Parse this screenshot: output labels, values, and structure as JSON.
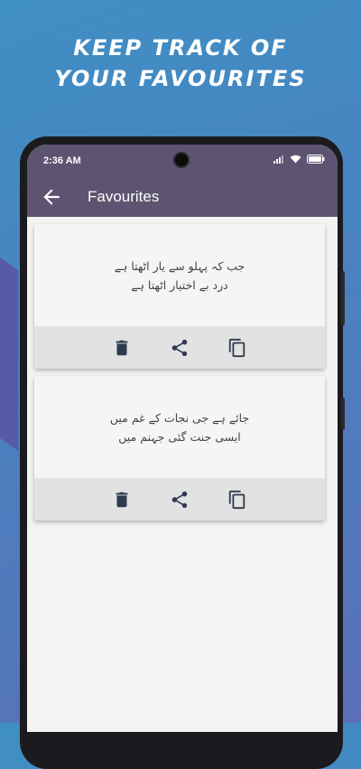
{
  "headline": [
    "KEEP TRACK OF",
    "YOUR FAVOURITES"
  ],
  "status_bar": {
    "time": "2:36 AM"
  },
  "app_bar": {
    "title": "Favourites"
  },
  "cards": [
    {
      "lines": [
        "جب کہ پہلو سے یار اٹھتا ہے",
        "درد بے اختیار اٹھتا ہے"
      ]
    },
    {
      "lines": [
        "جائے ہے جی نجات کے غم میں",
        "ایسی جنت گئی جہنم میں"
      ]
    }
  ],
  "icons": {
    "back": "arrow-back-icon",
    "delete": "trash-icon",
    "share": "share-icon",
    "copy": "copy-icon"
  },
  "colors": {
    "appbar": "#5c5470",
    "actions_bar": "#e2e2e2",
    "icon": "#2e3a4e"
  }
}
